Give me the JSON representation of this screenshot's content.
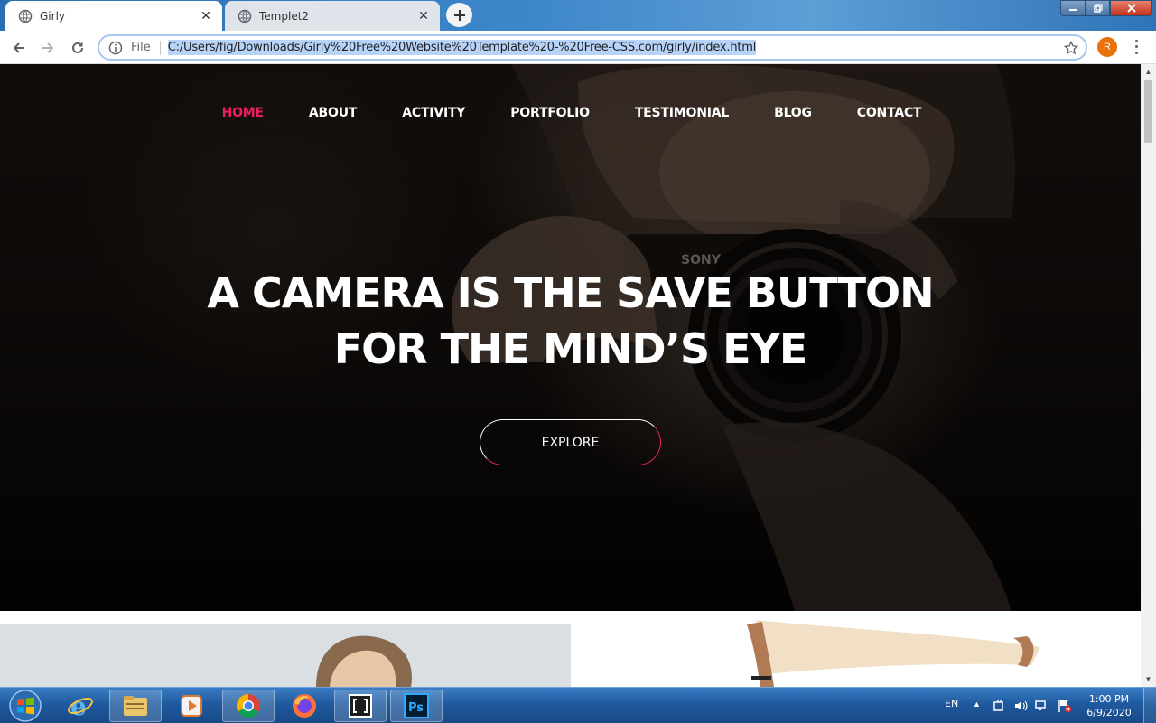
{
  "browser": {
    "tabs": [
      {
        "title": "Girly",
        "active": true
      },
      {
        "title": "Templet2",
        "active": false
      }
    ],
    "address": {
      "scheme_label": "File",
      "url": "C:/Users/fig/Downloads/Girly%20Free%20Website%20Template%20-%20Free-CSS.com/girly/index.html"
    },
    "profile_initial": "R"
  },
  "page": {
    "nav": {
      "items": [
        "HOME",
        "ABOUT",
        "ACTIVITY",
        "PORTFOLIO",
        "TESTIMONIAL",
        "BLOG",
        "CONTACT"
      ],
      "current": "HOME"
    },
    "hero": {
      "headline_line1": "A CAMERA IS THE SAVE BUTTON",
      "headline_line2": "FOR THE MIND’S EYE",
      "button_label": "EXPLORE"
    },
    "camera_brand_text": "SONY",
    "accent_color": "#e91e63"
  },
  "taskbar": {
    "apps": [
      "start-orb",
      "internet-explorer",
      "file-explorer",
      "media-player",
      "chrome",
      "firefox",
      "brackets",
      "photoshop"
    ],
    "language": "EN",
    "time": "1:00 PM",
    "date": "6/9/2020"
  }
}
